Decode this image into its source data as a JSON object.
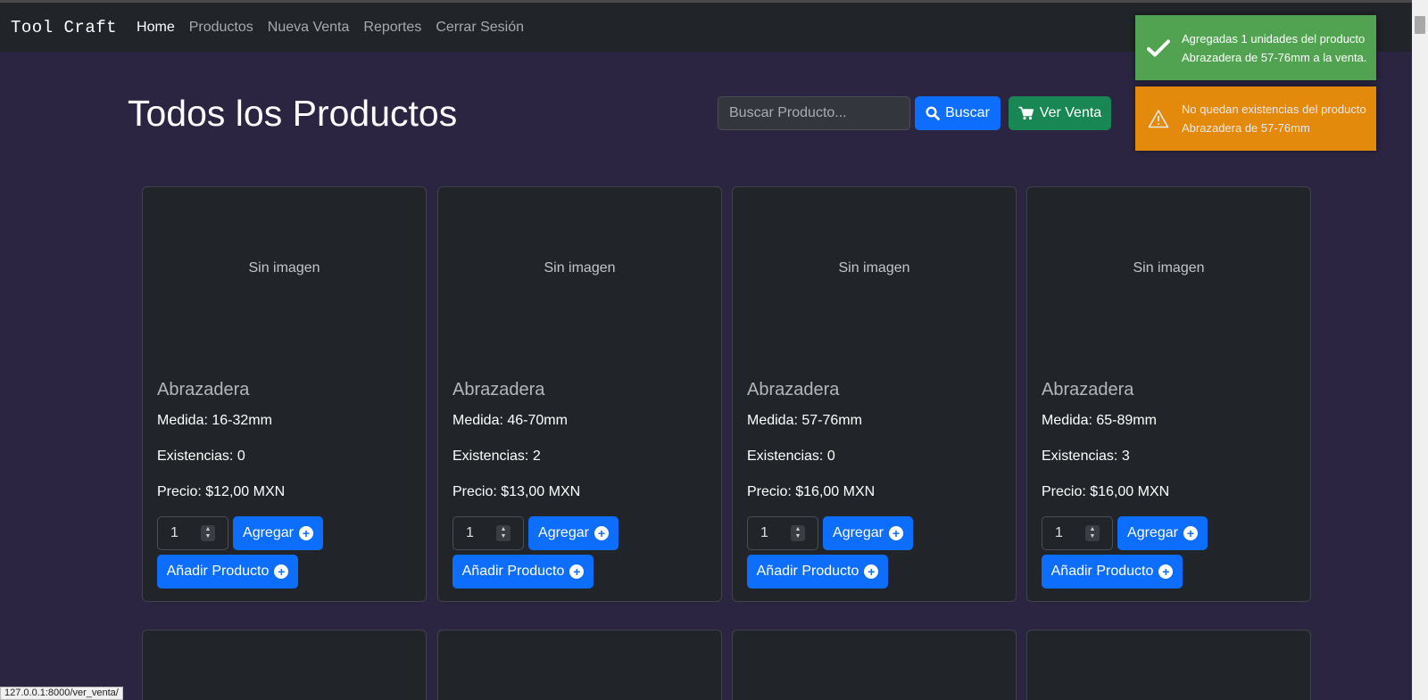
{
  "navbar": {
    "brand": "Tool Craft",
    "links": [
      "Home",
      "Productos",
      "Nueva Venta",
      "Reportes",
      "Cerrar Sesión"
    ]
  },
  "header": {
    "title": "Todos los Productos",
    "search_placeholder": "Buscar Producto...",
    "search_button": "Buscar",
    "venta_button": "Ver Venta"
  },
  "toasts": {
    "success": "Agregadas 1 unidades del producto Abrazadera de 57-76mm a la venta.",
    "warning": "No quedan existencias del producto Abrazadera de 57-76mm"
  },
  "products": [
    {
      "placeholder": "Sin imagen",
      "name": "Abrazadera",
      "medida": "Medida: 16-32mm",
      "existencias": "Existencias: 0",
      "precio": "Precio: $12,00 MXN",
      "qty": "1",
      "add_label": "Agregar",
      "anadir_label": "Añadir Producto"
    },
    {
      "placeholder": "Sin imagen",
      "name": "Abrazadera",
      "medida": "Medida: 46-70mm",
      "existencias": "Existencias: 2",
      "precio": "Precio: $13,00 MXN",
      "qty": "1",
      "add_label": "Agregar",
      "anadir_label": "Añadir Producto"
    },
    {
      "placeholder": "Sin imagen",
      "name": "Abrazadera",
      "medida": "Medida: 57-76mm",
      "existencias": "Existencias: 0",
      "precio": "Precio: $16,00 MXN",
      "qty": "1",
      "add_label": "Agregar",
      "anadir_label": "Añadir Producto"
    },
    {
      "placeholder": "Sin imagen",
      "name": "Abrazadera",
      "medida": "Medida: 65-89mm",
      "existencias": "Existencias: 3",
      "precio": "Precio: $16,00 MXN",
      "qty": "1",
      "add_label": "Agregar",
      "anadir_label": "Añadir Producto"
    }
  ],
  "status_url": "127.0.0.1:8000/ver_venta/",
  "colors": {
    "background": "#2b2541",
    "navbar": "#212429",
    "card": "#212529",
    "primary": "#0d6efd",
    "success_button": "#198754",
    "toast_success": "#51a351",
    "toast_warning": "#f89406"
  }
}
